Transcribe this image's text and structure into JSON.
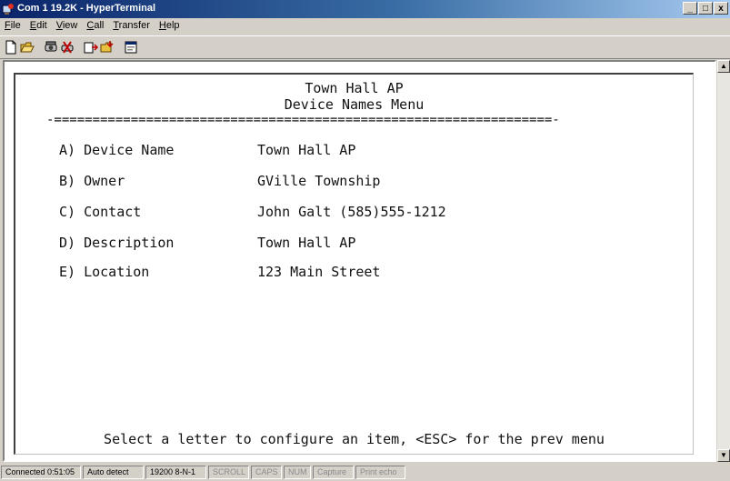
{
  "window": {
    "title": "Com 1 19.2K - HyperTerminal",
    "controls": {
      "minimize": "_",
      "maximize": "□",
      "close": "x"
    }
  },
  "menubar": {
    "items": [
      {
        "acc": "F",
        "rest": "ile"
      },
      {
        "acc": "E",
        "rest": "dit"
      },
      {
        "acc": "V",
        "rest": "iew"
      },
      {
        "acc": "C",
        "rest": "all"
      },
      {
        "acc": "T",
        "rest": "ransfer"
      },
      {
        "acc": "H",
        "rest": "elp"
      }
    ]
  },
  "toolbar": {
    "icons": [
      "new-icon",
      "open-icon",
      "connect-icon",
      "disconnect-icon",
      "send-icon",
      "receive-icon",
      "properties-icon"
    ]
  },
  "terminal": {
    "header_title": "Town Hall AP",
    "header_subtitle": "Device Names Menu",
    "separator": "-=================================================================-",
    "menu": [
      {
        "key": "A) Device Name",
        "value": "Town Hall AP"
      },
      {
        "key": "B) Owner",
        "value": "GVille Township"
      },
      {
        "key": "C) Contact",
        "value": "John Galt (585)555-1212"
      },
      {
        "key": "D) Description",
        "value": "Town Hall AP"
      },
      {
        "key": "E) Location",
        "value": "123 Main Street"
      }
    ],
    "prompt": "Select a letter to configure an item, <ESC> for the prev menu"
  },
  "statusbar": {
    "connected": "Connected 0:51:05",
    "detect": "Auto detect",
    "settings": "19200 8-N-1",
    "scroll": "SCROLL",
    "caps": "CAPS",
    "num": "NUM",
    "capture": "Capture",
    "print_echo": "Print echo"
  }
}
